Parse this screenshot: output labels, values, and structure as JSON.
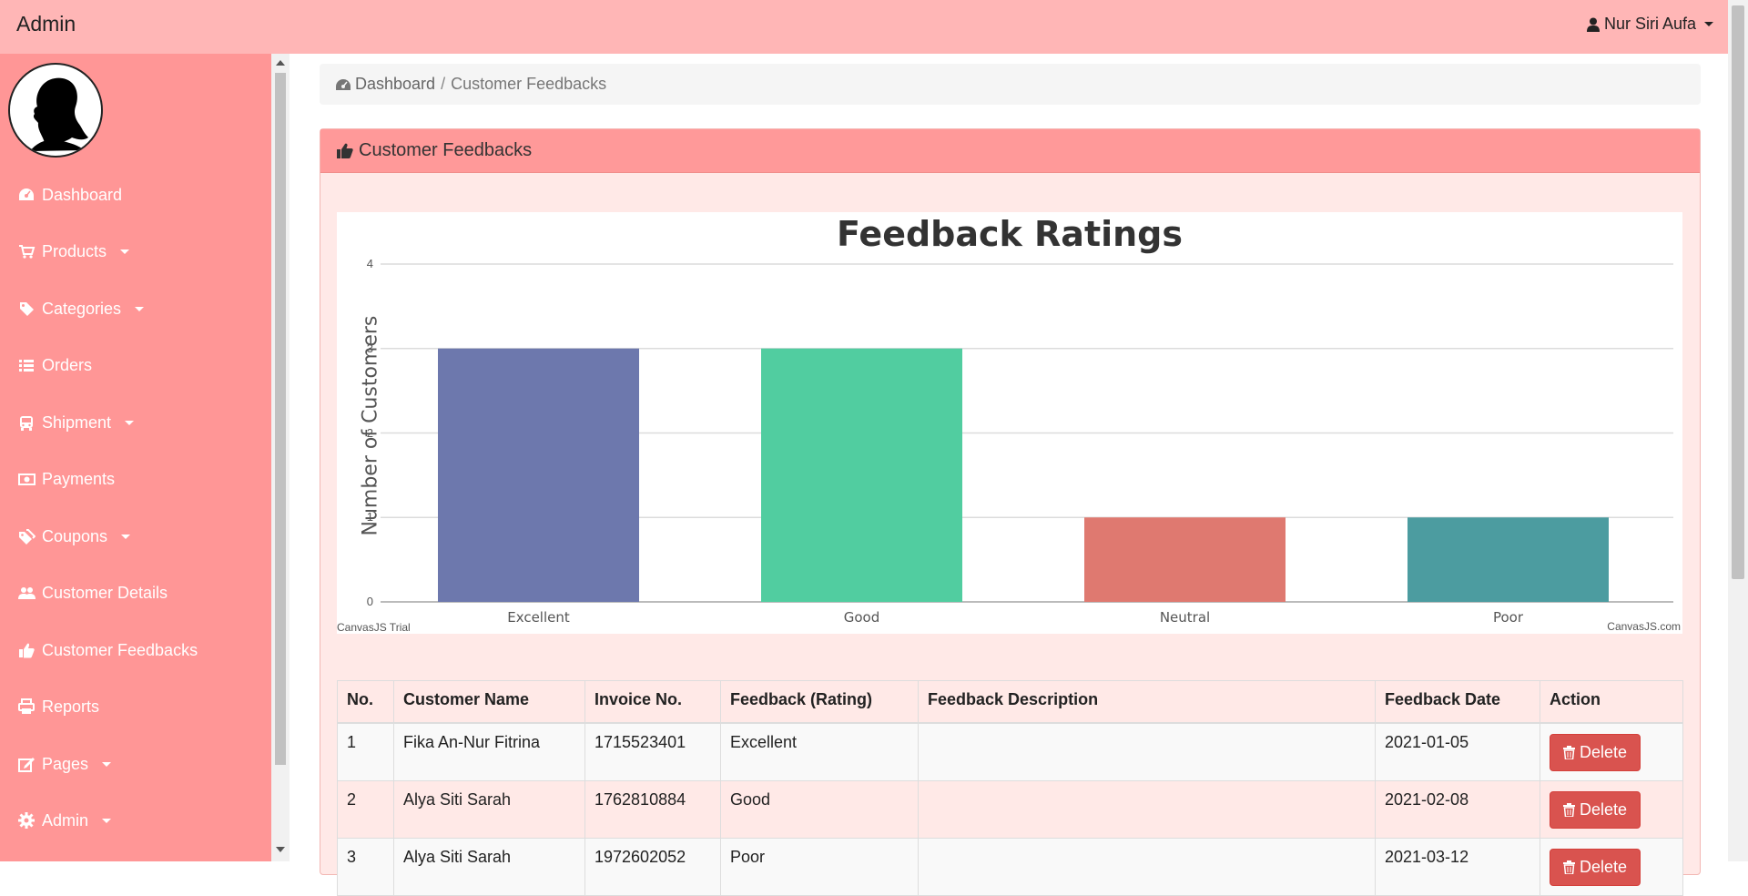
{
  "app": {
    "brand": "Admin",
    "user_name": "Nur Siri Aufa"
  },
  "sidebar": {
    "items": [
      {
        "label": "Dashboard",
        "icon": "dashboard-icon",
        "has_dropdown": false
      },
      {
        "label": "Products",
        "icon": "cart-icon",
        "has_dropdown": true
      },
      {
        "label": "Categories",
        "icon": "tag-icon",
        "has_dropdown": true
      },
      {
        "label": "Orders",
        "icon": "list-icon",
        "has_dropdown": false
      },
      {
        "label": "Shipment",
        "icon": "bus-icon",
        "has_dropdown": true
      },
      {
        "label": "Payments",
        "icon": "money-icon",
        "has_dropdown": false
      },
      {
        "label": "Coupons",
        "icon": "tags-icon",
        "has_dropdown": true
      },
      {
        "label": "Customer Details",
        "icon": "users-icon",
        "has_dropdown": false
      },
      {
        "label": "Customer Feedbacks",
        "icon": "thumbs-up-icon",
        "has_dropdown": false
      },
      {
        "label": "Reports",
        "icon": "print-icon",
        "has_dropdown": false
      },
      {
        "label": "Pages",
        "icon": "edit-icon",
        "has_dropdown": true
      },
      {
        "label": "Admin",
        "icon": "gear-icon",
        "has_dropdown": true
      }
    ]
  },
  "breadcrumb": {
    "root": "Dashboard",
    "separator": "/",
    "current": "Customer Feedbacks"
  },
  "panel": {
    "title": "Customer Feedbacks"
  },
  "chart_data": {
    "type": "bar",
    "title": "Feedback Ratings",
    "ylabel": "Number of Customers",
    "xlabel": "",
    "categories": [
      "Excellent",
      "Good",
      "Neutral",
      "Poor"
    ],
    "values": [
      3,
      3,
      1,
      1
    ],
    "colors": [
      "#6d78ad",
      "#51cda0",
      "#df7970",
      "#4c9ca0"
    ],
    "ylim": [
      0,
      4
    ],
    "yticks": [
      "0",
      "1",
      "2",
      "3",
      "4"
    ],
    "grid": true,
    "credit_left": "CanvasJS Trial",
    "credit_right": "CanvasJS.com"
  },
  "table": {
    "headers": [
      "No.",
      "Customer Name",
      "Invoice No.",
      "Feedback (Rating)",
      "Feedback Description",
      "Feedback Date",
      "Action"
    ],
    "delete_label": "Delete",
    "rows": [
      {
        "no": "1",
        "name": "Fika An-Nur Fitrina",
        "invoice": "1715523401",
        "rating": "Excellent",
        "description": "",
        "date": "2021-01-05"
      },
      {
        "no": "2",
        "name": "Alya Siti Sarah",
        "invoice": "1762810884",
        "rating": "Good",
        "description": "",
        "date": "2021-02-08"
      },
      {
        "no": "3",
        "name": "Alya Siti Sarah",
        "invoice": "1972602052",
        "rating": "Poor",
        "description": "",
        "date": "2021-03-12"
      }
    ]
  }
}
